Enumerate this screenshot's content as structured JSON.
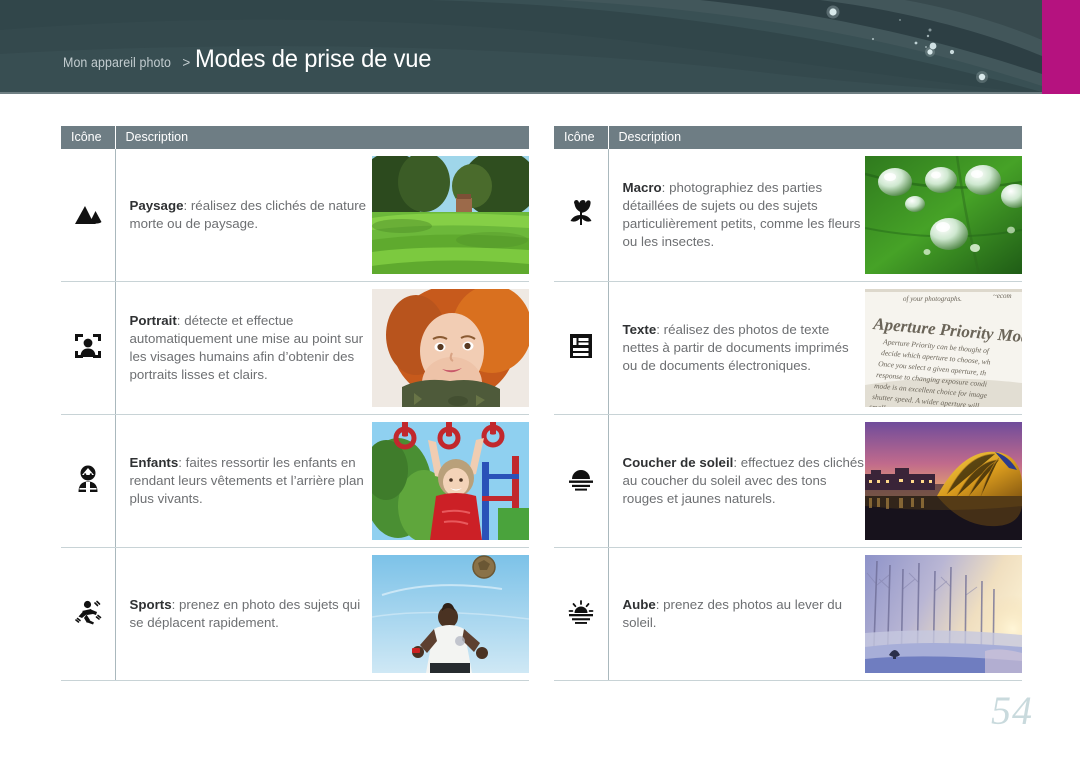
{
  "header": {
    "breadcrumb": "Mon appareil photo",
    "separator": ">",
    "title": "Modes de prise de vue",
    "accent_color": "#b5127f",
    "background_color": "#31464a"
  },
  "tables": {
    "header_background": "#6e7d84",
    "columns": {
      "icon": "Icône",
      "description": "Description"
    },
    "left": {
      "rows": [
        {
          "icon_name": "landscape-mountain-icon",
          "mode": "Paysage",
          "separator": ":",
          "description": "réalisez des clichés de nature morte ou de paysage.",
          "image_name": "landscape-park-photo",
          "image_alt": "Parc vert avec arbres et pelouse ensoleillée"
        },
        {
          "icon_name": "face-detection-icon",
          "mode": "Portrait",
          "separator": ":",
          "description": "détecte et effectue automatiquement une mise au point sur les visages humains afin d’obtenir des portraits lisses et clairs.",
          "image_name": "portrait-girl-photo",
          "image_alt": "Portrait d’une fillette rousse"
        },
        {
          "icon_name": "child-icon",
          "mode": "Enfants",
          "separator": ":",
          "description": "faites ressortir les enfants en rendant leurs vêtements et l’arrière plan plus vivants.",
          "image_name": "children-playground-photo",
          "image_alt": "Enfant en t-shirt rouge sur une aire de jeux"
        },
        {
          "icon_name": "running-person-icon",
          "mode": "Sports",
          "separator": ":",
          "description": "prenez en photo des sujets qui se déplacent rapidement.",
          "image_name": "sports-football-photo",
          "image_alt": "Joueur de football et ballon dans le ciel"
        }
      ]
    },
    "right": {
      "rows": [
        {
          "icon_name": "tulip-flower-icon",
          "mode": "Macro",
          "separator": ":",
          "description": "photographiez des parties détaillées de sujets ou des sujets particulièrement petits, comme les fleurs ou les insectes.",
          "image_name": "macro-waterdrops-photo",
          "image_alt": "Gouttes d’eau sur une feuille verte"
        },
        {
          "icon_name": "text-document-icon",
          "mode": "Texte",
          "separator": ":",
          "description": "réalisez des photos de texte nettes à partir de documents imprimés ou de documents électroniques.",
          "image_name": "text-book-page-photo",
          "image_alt": "Page de livre, Aperture Priority Mode"
        },
        {
          "icon_name": "sunset-icon",
          "mode": "Coucher de soleil",
          "separator": ":",
          "description": "effectuez des clichés au coucher du soleil avec des tons rouges et jaunes naturels.",
          "image_name": "sunset-dome-photo",
          "image_alt": "Bâtiment doré au coucher du soleil"
        },
        {
          "icon_name": "sunrise-icon",
          "mode": "Aube",
          "separator": ":",
          "description": "prenez des photos au lever du soleil.",
          "image_name": "dawn-winter-photo",
          "image_alt": "Allée d’arbres givrés à l’aube"
        }
      ]
    }
  },
  "footer": {
    "page_number": "54"
  }
}
